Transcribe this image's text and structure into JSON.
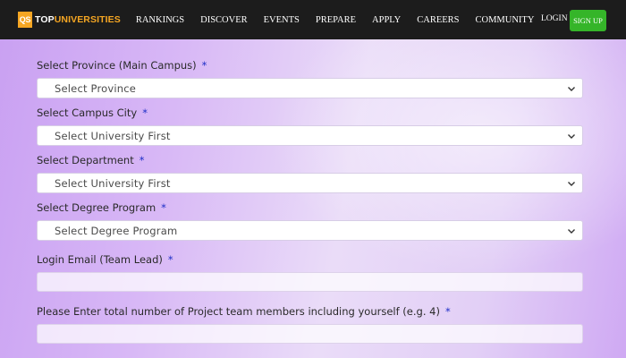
{
  "nav": {
    "logo_badge": "QS",
    "logo_top": "TOP",
    "logo_universities": "UNIVERSITIES",
    "menu": [
      "RANKINGS",
      "DISCOVER",
      "EVENTS",
      "PREPARE",
      "APPLY",
      "CAREERS",
      "COMMUNITY"
    ],
    "login": "LOGIN",
    "signup": "SIGN UP"
  },
  "form": {
    "required_mark": "*",
    "province": {
      "label": "Select Province (Main Campus)",
      "value": "Select Province"
    },
    "campus_city": {
      "label": "Select Campus City",
      "value": "Select University First"
    },
    "department": {
      "label": "Select Department",
      "value": "Select University First"
    },
    "degree_program": {
      "label": "Select Degree Program",
      "value": "Select Degree Program"
    },
    "login_email": {
      "label": "Login Email (Team Lead)",
      "value": ""
    },
    "team_members": {
      "label": "Please Enter total number of Project team members including yourself (e.g. 4)",
      "value": ""
    }
  },
  "colors": {
    "nav_bg": "#1c1c1c",
    "brand_orange": "#f5a623",
    "signup_green": "#35b529",
    "required_blue": "#1d2ec7"
  }
}
